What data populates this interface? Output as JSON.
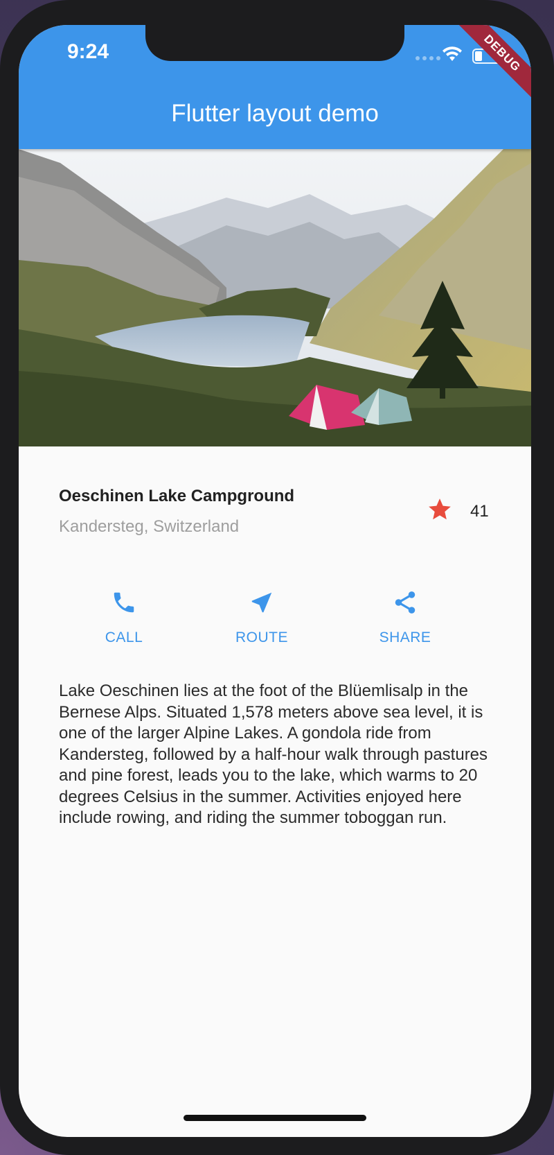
{
  "status_bar": {
    "time": "9:24"
  },
  "app_bar": {
    "title": "Flutter layout demo",
    "debug_banner": "DEBUG",
    "color": "#3d95ea"
  },
  "hero_image": {
    "subject": "mountain lake with tents"
  },
  "title_section": {
    "name": "Oeschinen Lake Campground",
    "location": "Kandersteg, Switzerland",
    "rating_count": "41",
    "star_color": "#e84c3d"
  },
  "actions": [
    {
      "icon": "phone-icon",
      "label": "CALL"
    },
    {
      "icon": "navigation-icon",
      "label": "ROUTE"
    },
    {
      "icon": "share-icon",
      "label": "SHARE"
    }
  ],
  "description": "Lake Oeschinen lies at the foot of the Blüemlisalp in the Bernese Alps. Situated 1,578 meters above sea level, it is one of the larger Alpine Lakes. A gondola ride from Kandersteg, followed by a half-hour walk through pastures and pine forest, leads you to the lake, which warms to 20 degrees Celsius in the summer. Activities enjoyed here include rowing, and riding the summer toboggan run."
}
